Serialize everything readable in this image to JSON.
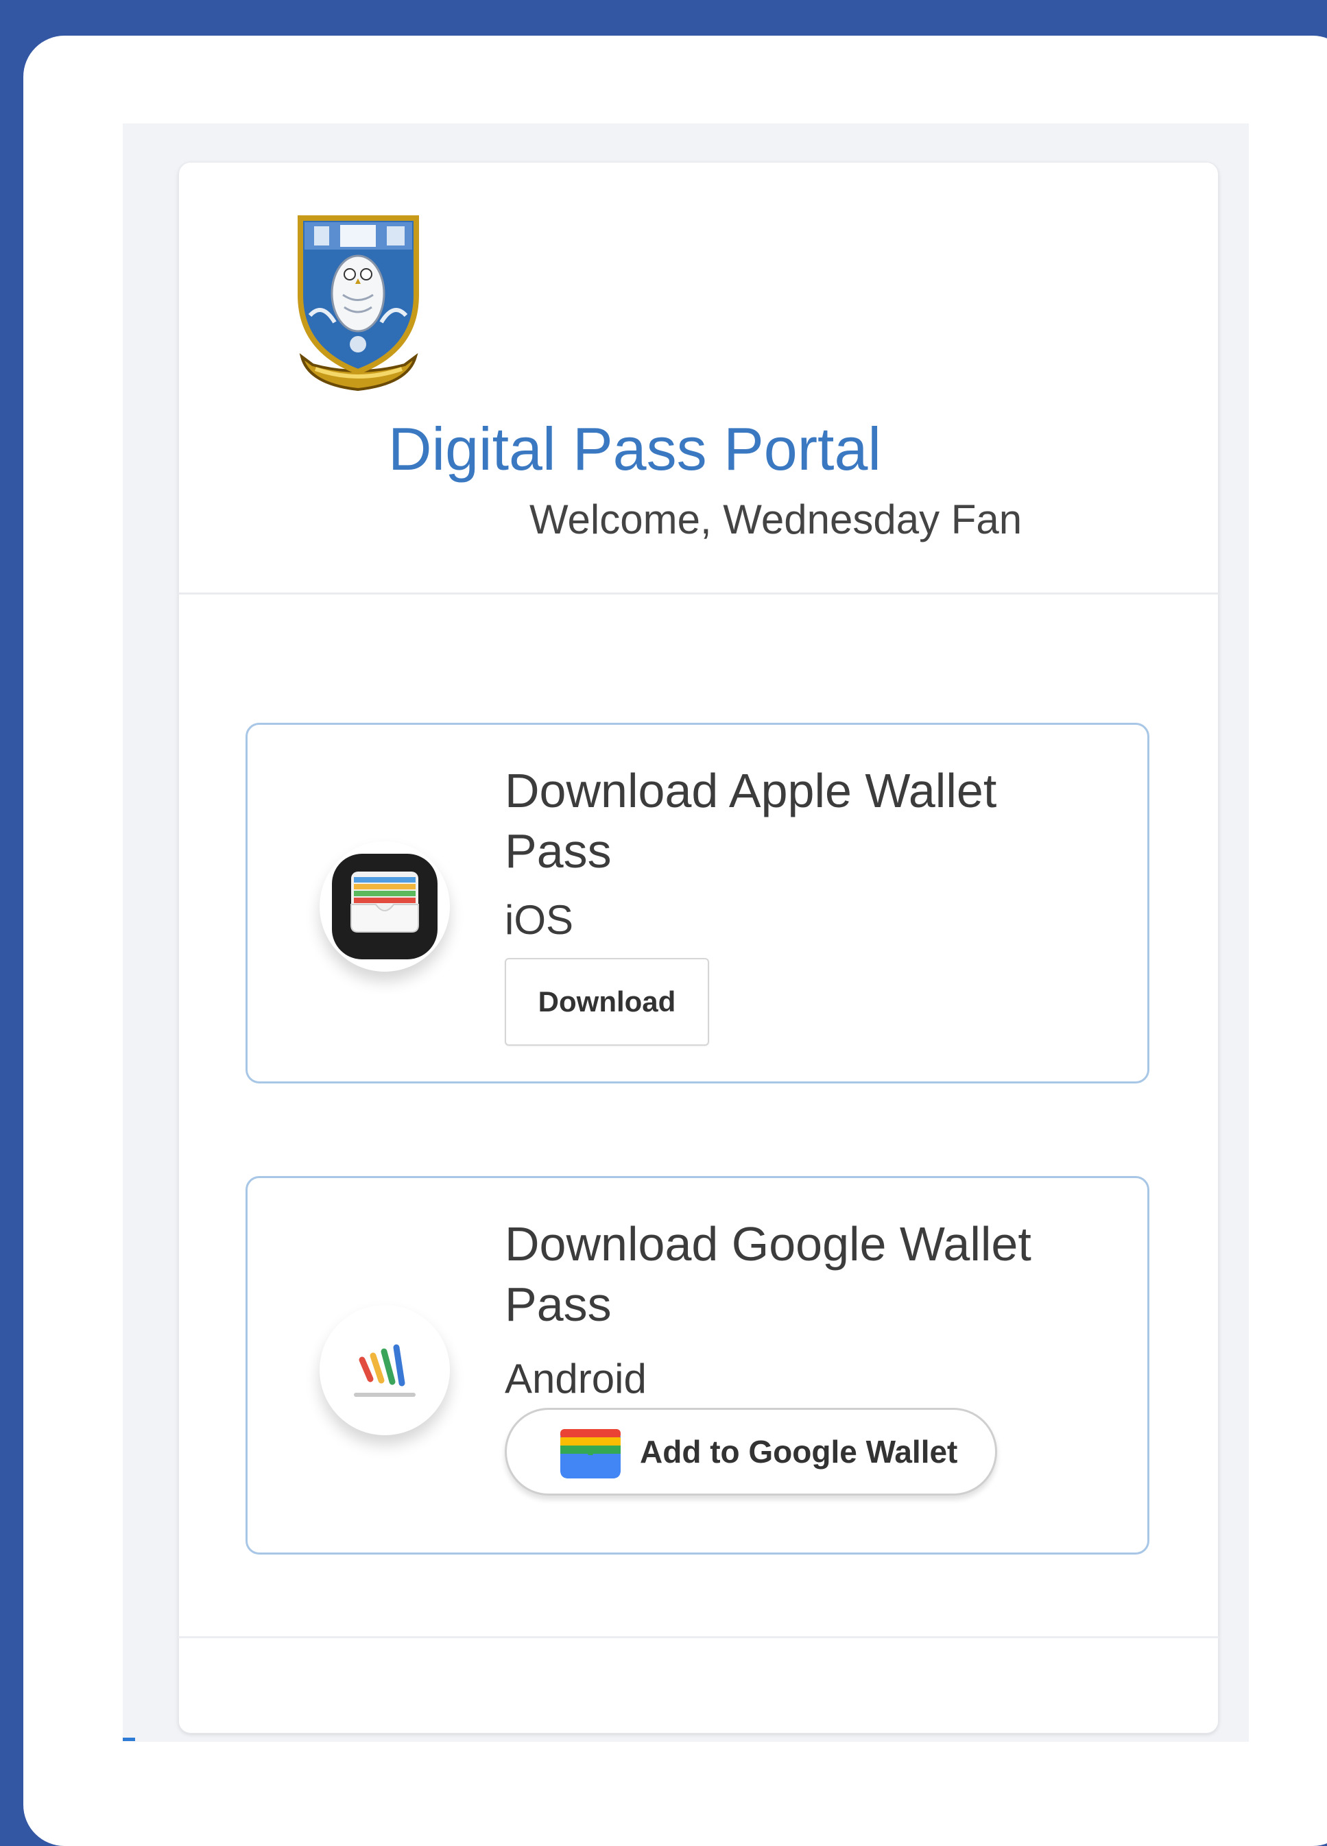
{
  "portal": {
    "title": "Digital Pass Portal",
    "welcome": "Welcome, Wednesday Fan",
    "logo": "sheffield-wednesday-crest"
  },
  "apple_card": {
    "title": "Download Apple Wallet Pass",
    "platform": "iOS",
    "button_label": "Download",
    "icon": "apple-wallet-icon"
  },
  "google_card": {
    "title": "Download Google Wallet Pass",
    "platform": "Android",
    "button_label": "Add to Google Wallet",
    "icon": "google-wallet-icon"
  },
  "colors": {
    "background": "#3457a4",
    "title_blue": "#3a78c2",
    "card_border": "#a8c6e6"
  }
}
